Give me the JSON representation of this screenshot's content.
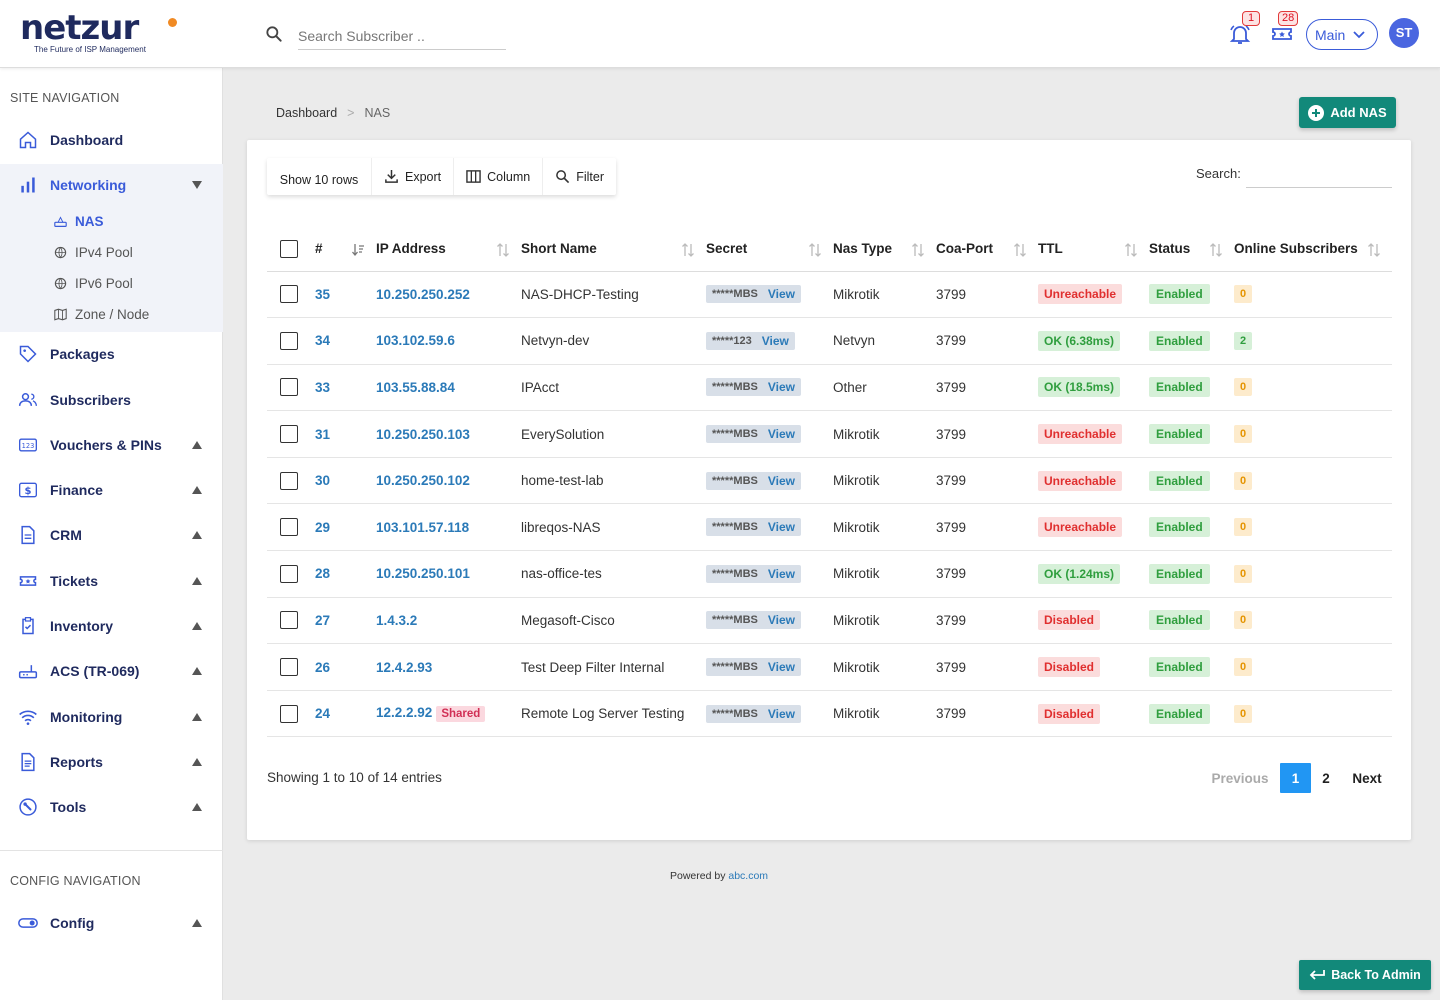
{
  "brand": {
    "name": "netzur",
    "tagline": "The Future of ISP Management"
  },
  "header": {
    "search_placeholder": "Search Subscriber ..",
    "notifications_count": "1",
    "tickets_count": "28",
    "workspace": "Main",
    "avatar_initials": "ST"
  },
  "sidebar": {
    "site_section": "SITE NAVIGATION",
    "config_section": "CONFIG NAVIGATION",
    "items": [
      {
        "label": "Dashboard"
      },
      {
        "label": "Networking"
      },
      {
        "label": "Packages"
      },
      {
        "label": "Subscribers"
      },
      {
        "label": "Vouchers & PINs"
      },
      {
        "label": "Finance"
      },
      {
        "label": "CRM"
      },
      {
        "label": "Tickets"
      },
      {
        "label": "Inventory"
      },
      {
        "label": "ACS (TR-069)"
      },
      {
        "label": "Monitoring"
      },
      {
        "label": "Reports"
      },
      {
        "label": "Tools"
      },
      {
        "label": "Config"
      }
    ],
    "networking_sub": [
      {
        "label": "NAS"
      },
      {
        "label": "IPv4 Pool"
      },
      {
        "label": "IPv6 Pool"
      },
      {
        "label": "Zone / Node"
      }
    ]
  },
  "breadcrumb": {
    "root": "Dashboard",
    "sep": ">",
    "current": "NAS"
  },
  "add_button": "Add NAS",
  "toolbar": {
    "rows": "Show 10 rows",
    "export": "Export",
    "column": "Column",
    "filter": "Filter"
  },
  "search_label": "Search:",
  "table": {
    "columns": [
      "#",
      "IP Address",
      "Short Name",
      "Secret",
      "Nas Type",
      "Coa-Port",
      "TTL",
      "Status",
      "Online Subscribers"
    ],
    "rows": [
      {
        "id": "35",
        "ip": "10.250.250.252",
        "shared": "",
        "name": "NAS-DHCP-Testing",
        "secret": "*****MBS",
        "view": "View",
        "type": "Mikrotik",
        "coa": "3799",
        "ttl": "Unreachable",
        "ttl_state": "bad",
        "status": "Enabled",
        "online": "0"
      },
      {
        "id": "34",
        "ip": "103.102.59.6",
        "shared": "",
        "name": "Netvyn-dev",
        "secret": "*****123",
        "view": "View",
        "type": "Netvyn",
        "coa": "3799",
        "ttl": "OK (6.38ms)",
        "ttl_state": "ok",
        "status": "Enabled",
        "online": "2"
      },
      {
        "id": "33",
        "ip": "103.55.88.84",
        "shared": "",
        "name": "IPAcct",
        "secret": "*****MBS",
        "view": "View",
        "type": "Other",
        "coa": "3799",
        "ttl": "OK (18.5ms)",
        "ttl_state": "ok",
        "status": "Enabled",
        "online": "0"
      },
      {
        "id": "31",
        "ip": "10.250.250.103",
        "shared": "",
        "name": "EverySolution",
        "secret": "*****MBS",
        "view": "View",
        "type": "Mikrotik",
        "coa": "3799",
        "ttl": "Unreachable",
        "ttl_state": "bad",
        "status": "Enabled",
        "online": "0"
      },
      {
        "id": "30",
        "ip": "10.250.250.102",
        "shared": "",
        "name": "home-test-lab",
        "secret": "*****MBS",
        "view": "View",
        "type": "Mikrotik",
        "coa": "3799",
        "ttl": "Unreachable",
        "ttl_state": "bad",
        "status": "Enabled",
        "online": "0"
      },
      {
        "id": "29",
        "ip": "103.101.57.118",
        "shared": "",
        "name": "libreqos-NAS",
        "secret": "*****MBS",
        "view": "View",
        "type": "Mikrotik",
        "coa": "3799",
        "ttl": "Unreachable",
        "ttl_state": "bad",
        "status": "Enabled",
        "online": "0"
      },
      {
        "id": "28",
        "ip": "10.250.250.101",
        "shared": "",
        "name": "nas-office-tes",
        "secret": "*****MBS",
        "view": "View",
        "type": "Mikrotik",
        "coa": "3799",
        "ttl": "OK (1.24ms)",
        "ttl_state": "ok",
        "status": "Enabled",
        "online": "0"
      },
      {
        "id": "27",
        "ip": "1.4.3.2",
        "shared": "",
        "name": "Megasoft-Cisco",
        "secret": "*****MBS",
        "view": "View",
        "type": "Mikrotik",
        "coa": "3799",
        "ttl": "Disabled",
        "ttl_state": "bad",
        "status": "Enabled",
        "online": "0"
      },
      {
        "id": "26",
        "ip": "12.4.2.93",
        "shared": "",
        "name": "Test Deep Filter Internal",
        "secret": "*****MBS",
        "view": "View",
        "type": "Mikrotik",
        "coa": "3799",
        "ttl": "Disabled",
        "ttl_state": "bad",
        "status": "Enabled",
        "online": "0"
      },
      {
        "id": "24",
        "ip": "12.2.2.92",
        "shared": "Shared",
        "name": "Remote Log Server Testing",
        "secret": "*****MBS",
        "view": "View",
        "type": "Mikrotik",
        "coa": "3799",
        "ttl": "Disabled",
        "ttl_state": "bad",
        "status": "Enabled",
        "online": "0"
      }
    ]
  },
  "showing": "Showing 1 to 10 of 14 entries",
  "pagination": {
    "previous": "Previous",
    "current": "1",
    "page2": "2",
    "next": "Next"
  },
  "footer": {
    "text": "Powered by",
    "link": "abc.com"
  },
  "back_button": "Back To Admin",
  "colors": {
    "brand_navy": "#1f2a5e",
    "accent_blue": "#3a5bd9",
    "teal": "#12897a",
    "link_blue": "#2b7ab8",
    "page_blue": "#2196f3"
  }
}
